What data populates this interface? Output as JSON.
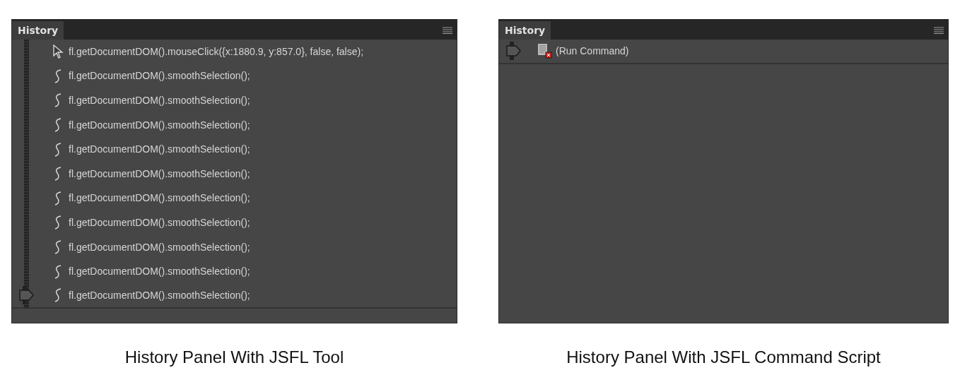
{
  "figures": [
    {
      "panel": {
        "tab": "History",
        "items": [
          {
            "kind": "arrow",
            "text": "fl.getDocumentDOM().mouseClick({x:1880.9, y:857.0}, false, false);",
            "current": false
          },
          {
            "kind": "smooth",
            "text": "fl.getDocumentDOM().smoothSelection();",
            "current": false
          },
          {
            "kind": "smooth",
            "text": "fl.getDocumentDOM().smoothSelection();",
            "current": false
          },
          {
            "kind": "smooth",
            "text": "fl.getDocumentDOM().smoothSelection();",
            "current": false
          },
          {
            "kind": "smooth",
            "text": "fl.getDocumentDOM().smoothSelection();",
            "current": false
          },
          {
            "kind": "smooth",
            "text": "fl.getDocumentDOM().smoothSelection();",
            "current": false
          },
          {
            "kind": "smooth",
            "text": "fl.getDocumentDOM().smoothSelection();",
            "current": false
          },
          {
            "kind": "smooth",
            "text": "fl.getDocumentDOM().smoothSelection();",
            "current": false
          },
          {
            "kind": "smooth",
            "text": "fl.getDocumentDOM().smoothSelection();",
            "current": false
          },
          {
            "kind": "smooth",
            "text": "fl.getDocumentDOM().smoothSelection();",
            "current": false
          },
          {
            "kind": "smooth",
            "text": "fl.getDocumentDOM().smoothSelection();",
            "current": true
          }
        ]
      },
      "caption": "History Panel With JSFL Tool"
    },
    {
      "panel": {
        "tab": "History",
        "items": [
          {
            "kind": "command",
            "text": "(Run Command)",
            "current": true
          }
        ]
      },
      "caption": "History Panel With JSFL Command Script"
    }
  ]
}
